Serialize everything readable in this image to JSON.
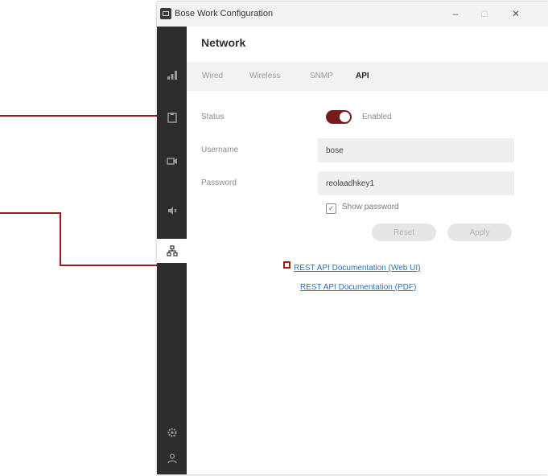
{
  "window": {
    "title": "Bose Work Configuration",
    "controls": {
      "minimize": "–",
      "maximize": "□",
      "close": "✕"
    }
  },
  "sidebar": {
    "items": [
      {
        "icon": "signal-icon",
        "active": false
      },
      {
        "icon": "clipboard-icon",
        "active": false
      },
      {
        "icon": "camera-icon",
        "active": false
      },
      {
        "icon": "speaker-icon",
        "active": false
      },
      {
        "icon": "network-icon",
        "active": true
      },
      {
        "icon": "gear-icon",
        "active": false
      },
      {
        "icon": "user-icon",
        "active": false
      }
    ]
  },
  "page": {
    "title": "Network",
    "tabs": [
      {
        "label": "Wired",
        "active": false
      },
      {
        "label": "Wireless",
        "active": false
      },
      {
        "label": "SNMP",
        "active": false
      },
      {
        "label": "API",
        "active": true
      }
    ]
  },
  "form": {
    "status_label": "Status",
    "status_value": "Enabled",
    "username_label": "Username",
    "username_value": "bose",
    "password_label": "Password",
    "password_value": "reolaadhkey1",
    "show_password_label": "Show password",
    "reset_label": "Reset",
    "apply_label": "Apply"
  },
  "links": {
    "web_ui": "REST API Documentation (Web UI)",
    "pdf": "REST API Documentation (PDF)"
  },
  "colors": {
    "accent": "#7a1a1a",
    "callout": "#9b1b1b",
    "link": "#2f6fb5",
    "sidebar": "#2d2d2d"
  }
}
